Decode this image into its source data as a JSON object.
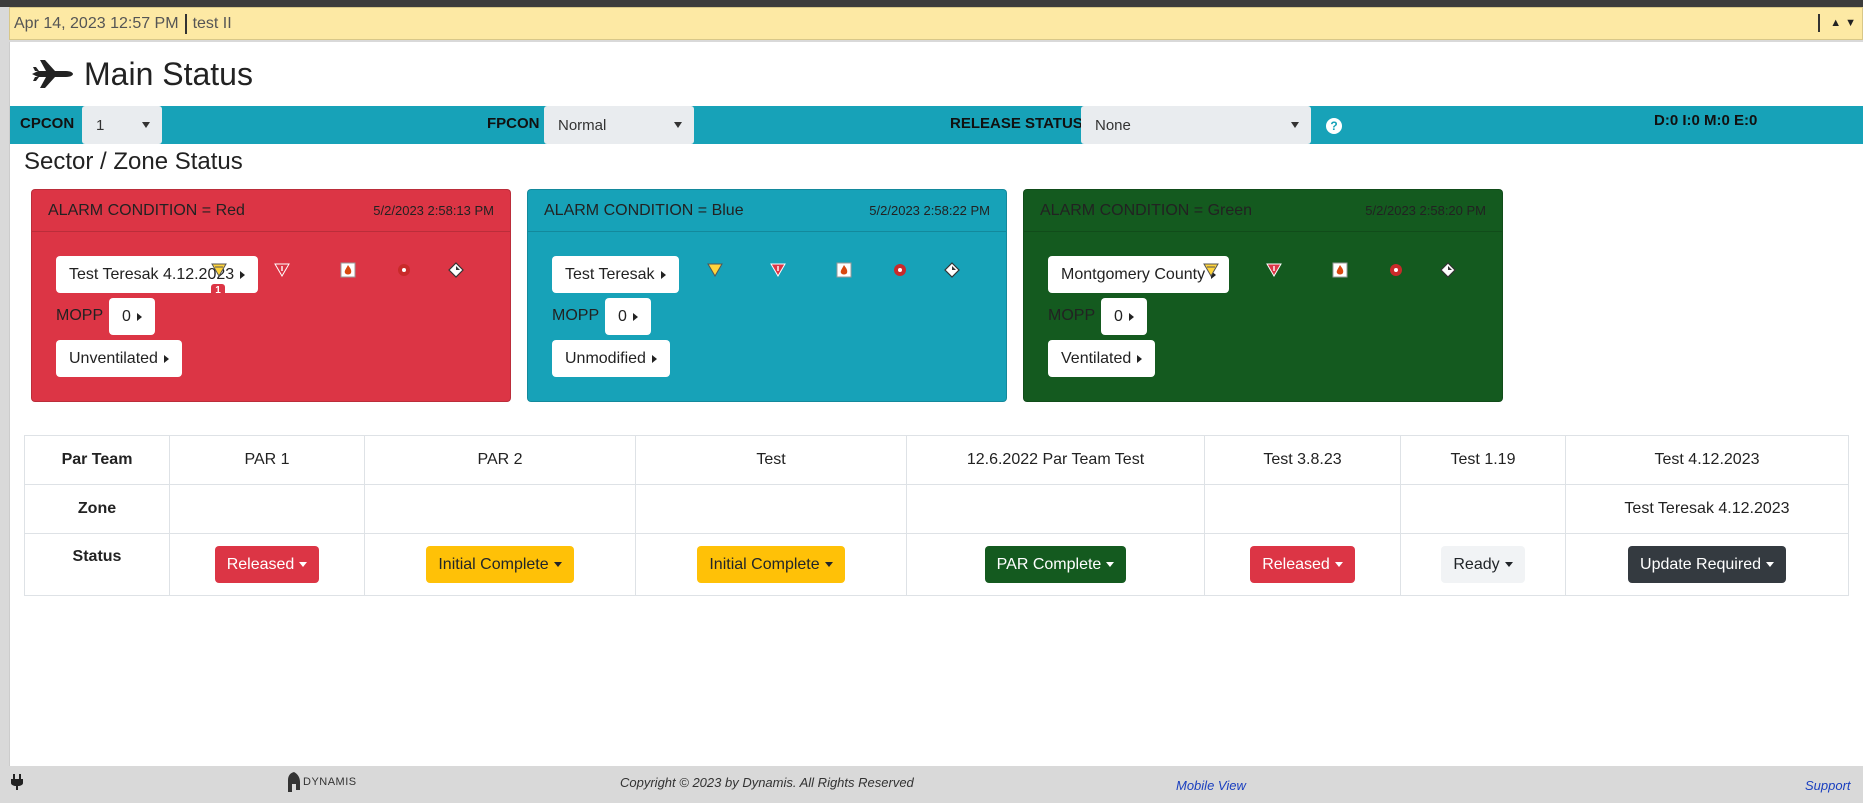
{
  "titlebar": {
    "datetime": "Apr 14, 2023 12:57 PM",
    "user": "test II"
  },
  "header": {
    "title": "Main Status"
  },
  "conditions": {
    "cpcon": {
      "label": "CPCON",
      "value": "1"
    },
    "fpcon": {
      "label": "FPCON",
      "value": "Normal"
    },
    "release": {
      "label": "RELEASE STATUS",
      "value": "None"
    },
    "counts": "D:0 I:0 M:0 E:0"
  },
  "sector": {
    "title": "Sector / Zone Status",
    "zones": [
      {
        "alarm": "ALARM CONDITION = Red",
        "timestamp": "5/2/2023 2:58:13 PM",
        "name": "Test Teresak 4.12.2023",
        "badge": "1",
        "mopp_label": "MOPP",
        "mopp": "0",
        "ventilation": "Unventilated",
        "color": "#dc3545"
      },
      {
        "alarm": "ALARM CONDITION = Blue",
        "timestamp": "5/2/2023 2:58:22 PM",
        "name": "Test Teresak",
        "mopp_label": "MOPP",
        "mopp": "0",
        "ventilation": "Unmodified",
        "color": "#17a2b8"
      },
      {
        "alarm": "ALARM CONDITION = Green",
        "timestamp": "5/2/2023 2:58:20 PM",
        "name": "Montgomery County",
        "mopp_label": "MOPP",
        "mopp": "0",
        "ventilation": "Ventilated",
        "color": "#145a1f"
      }
    ]
  },
  "par_table": {
    "row_labels": [
      "Par Team",
      "Zone",
      "Status"
    ],
    "teams": [
      {
        "name": "PAR 1",
        "zone": "",
        "status": "Released",
        "bg": "#dc3545",
        "fg": "#ffffff"
      },
      {
        "name": "PAR 2",
        "zone": "",
        "status": "Initial Complete",
        "bg": "#ffc107",
        "fg": "#212529"
      },
      {
        "name": "Test",
        "zone": "",
        "status": "Initial Complete",
        "bg": "#ffc107",
        "fg": "#212529"
      },
      {
        "name": "12.6.2022 Par Team Test",
        "zone": "",
        "status": "PAR Complete",
        "bg": "#145a1f",
        "fg": "#ffffff"
      },
      {
        "name": "Test 3.8.23",
        "zone": "",
        "status": "Released",
        "bg": "#dc3545",
        "fg": "#ffffff"
      },
      {
        "name": "Test 1.19",
        "zone": "",
        "status": "Ready",
        "bg": "#f1f3f5",
        "fg": "#212529"
      },
      {
        "name": "Test 4.12.2023",
        "zone": "Test Teresak 4.12.2023",
        "status": "Update Required",
        "bg": "#343a40",
        "fg": "#ffffff"
      }
    ]
  },
  "footer": {
    "logo_text": "DYNAMIS",
    "copyright": "Copyright © 2023 by Dynamis. All Rights Reserved",
    "mobile_view": "Mobile View",
    "support": "Support"
  }
}
